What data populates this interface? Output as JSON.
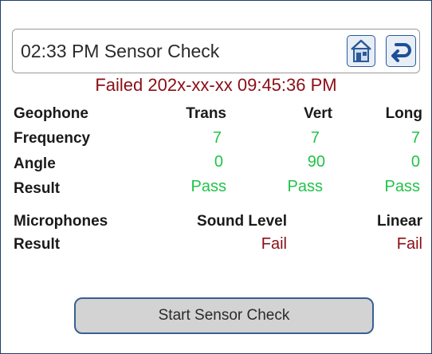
{
  "header": {
    "time": "02:33 PM",
    "title": "Sensor Check"
  },
  "status": "Failed 202x-xx-xx 09:45:36 PM",
  "geophone": {
    "label": "Geophone",
    "columns": [
      "Trans",
      "Vert",
      "Long"
    ],
    "frequency_label": "Frequency",
    "frequency": [
      "7",
      "7",
      "7"
    ],
    "angle_label": "Angle",
    "angle": [
      "0",
      "90",
      "0"
    ],
    "result_label": "Result",
    "result": [
      "Pass",
      "Pass",
      "Pass"
    ]
  },
  "microphones": {
    "label": "Microphones",
    "columns": [
      "Sound Level",
      "Linear"
    ],
    "result_label": "Result",
    "result": [
      "Fail",
      "Fail"
    ]
  },
  "start_button_label": "Start Sensor Check",
  "icons": {
    "home": "home-icon",
    "back": "back-arrow-icon"
  },
  "colors": {
    "fail": "#8b0e16",
    "pass": "#22c24a",
    "accent": "#2a5a9a"
  }
}
